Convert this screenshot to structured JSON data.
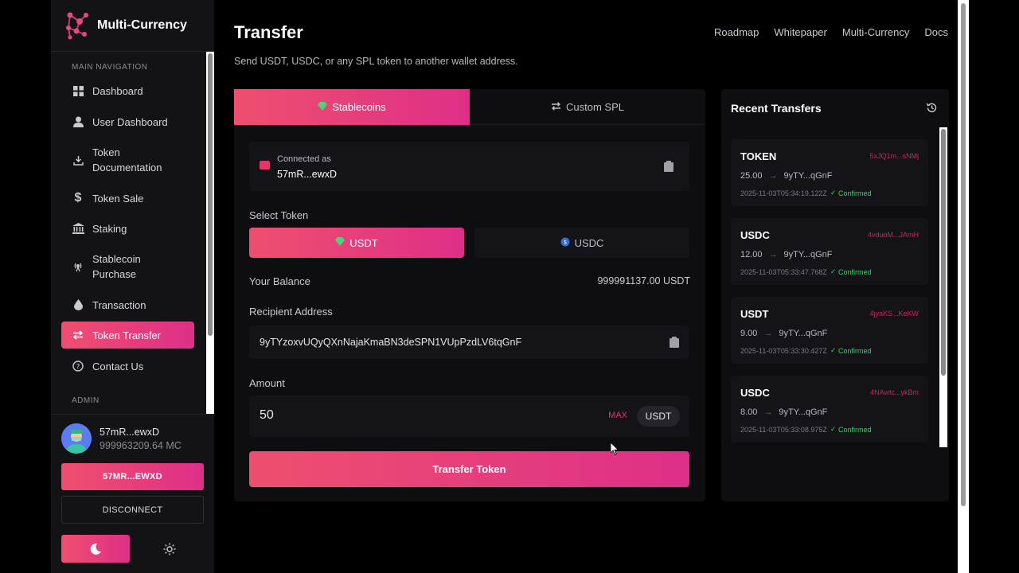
{
  "app": {
    "title": "Multi-Currency"
  },
  "sidebar": {
    "section_main": "MAIN NAVIGATION",
    "section_admin": "ADMIN",
    "items": [
      {
        "label": "Dashboard",
        "icon": "grid-icon"
      },
      {
        "label": "User Dashboard",
        "icon": "user-icon"
      },
      {
        "label": "Token\nDocumentation",
        "label_line1": "Token",
        "label_line2": "Documentation",
        "icon": "download-icon"
      },
      {
        "label": "Token Sale",
        "icon": "dollar-icon"
      },
      {
        "label": "Staking",
        "icon": "bank-icon"
      },
      {
        "label_line1": "Stablecoin",
        "label_line2": "Purchase",
        "icon": "broadcast-icon"
      },
      {
        "label": "Transaction",
        "icon": "drop-icon"
      },
      {
        "label": "Token Transfer",
        "icon": "swap-icon",
        "active": true
      },
      {
        "label": "Contact Us",
        "icon": "help-icon"
      }
    ],
    "user": {
      "name": "57mR...ewxD",
      "balance": "999963209.64 MC"
    },
    "wallet_button": "57MR...EWXD",
    "disconnect_button": "DISCONNECT"
  },
  "header": {
    "title": "Transfer",
    "subtitle": "Send USDT, USDC, or any SPL token to another wallet address.",
    "links": [
      "Roadmap",
      "Whitepaper",
      "Multi-Currency",
      "Docs"
    ]
  },
  "transfer": {
    "tabs": [
      {
        "label": "Stablecoins",
        "active": true
      },
      {
        "label": "Custom SPL",
        "active": false
      }
    ],
    "connected_label": "Connected as",
    "connected_address": "57mR...ewxD",
    "select_token_label": "Select Token",
    "tokens": [
      {
        "label": "USDT",
        "active": true
      },
      {
        "label": "USDC",
        "active": false
      }
    ],
    "balance_label": "Your Balance",
    "balance_value": "999991137.00 USDT",
    "recipient_label": "Recipient Address",
    "recipient_value": "9yTYzoxvUQyQXnNajaKmaBN3deSPN1VUpPzdLV6tqGnF",
    "amount_label": "Amount",
    "amount_value": "50",
    "max_label": "MAX",
    "amount_unit": "USDT",
    "submit_label": "Transfer Token"
  },
  "recent": {
    "title": "Recent Transfers",
    "transfers": [
      {
        "token": "TOKEN",
        "sig": "5xJQ1m...sNMj",
        "amount": "25.00",
        "to": "9yTY...qGnF",
        "time": "2025-11-03T05:34:19.122Z",
        "status": "Confirmed"
      },
      {
        "token": "USDC",
        "sig": "4vduoM...JAmH",
        "amount": "12.00",
        "to": "9yTY...qGnF",
        "time": "2025-11-03T05:33:47.768Z",
        "status": "Confirmed"
      },
      {
        "token": "USDT",
        "sig": "4jyaKS...KeKW",
        "amount": "9.00",
        "to": "9yTY...qGnF",
        "time": "2025-11-03T05:33:30.427Z",
        "status": "Confirmed"
      },
      {
        "token": "USDC",
        "sig": "4NAwtc...ykBm",
        "amount": "8.00",
        "to": "9yTY...qGnF",
        "time": "2025-11-03T05:33:08.975Z",
        "status": "Confirmed"
      }
    ]
  },
  "colors": {
    "accent_start": "#ef4f6f",
    "accent_end": "#de2f88",
    "success": "#3ecf6a"
  }
}
